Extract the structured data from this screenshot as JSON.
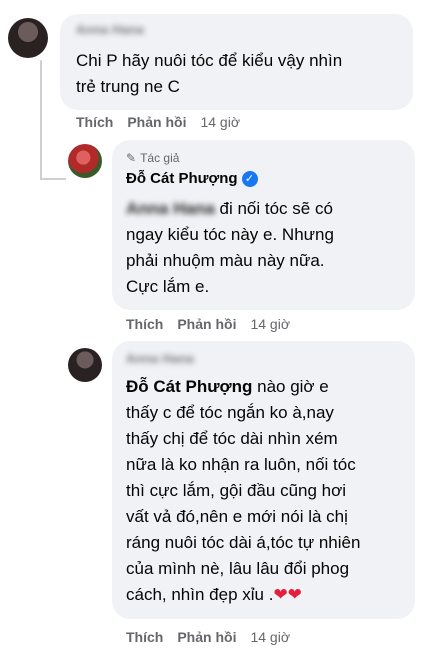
{
  "comments": [
    {
      "author": "Anna Hana",
      "text": "Chi P hãy nuôi tóc để kiểu vậy nhìn\ntrẻ trung ne C",
      "actions": {
        "like": "Thích",
        "reply": "Phản hồi",
        "time": "14 giờ"
      }
    },
    {
      "author_tag": "Tác giả",
      "author": "Đỗ Cát Phượng",
      "mention": "Anna Hana",
      "text": " đi nối tóc sẽ có\nngay kiểu tóc này e. Nhưng\nphải nhuộm màu này nữa.\nCực lắm e.",
      "actions": {
        "like": "Thích",
        "reply": "Phản hồi",
        "time": "14 giờ"
      }
    },
    {
      "author": "Anna Hana",
      "mention": "Đỗ Cát Phượng",
      "text": " nào giờ e\nthấy c để tóc ngắn ko à,nay\nthấy chị để tóc dài nhìn xém\nnữa là ko nhận ra luôn, nối tóc\nthì cực lắm, gội đầu cũng hơi\nvất vả đó,nên e mới nói là chị\nráng nuôi tóc dài á,tóc tự nhiên\ncủa mình nè, lâu lâu đổi phog\ncách, nhìn đẹp xỉu .",
      "hearts": "❤❤",
      "actions": {
        "like": "Thích",
        "reply": "Phản hồi",
        "time": "14 giờ"
      }
    }
  ],
  "colors": {
    "bubble": "#f0f2f5",
    "secondary_text": "#65676b",
    "verified": "#1877f2",
    "heart": "#e41e3f"
  }
}
